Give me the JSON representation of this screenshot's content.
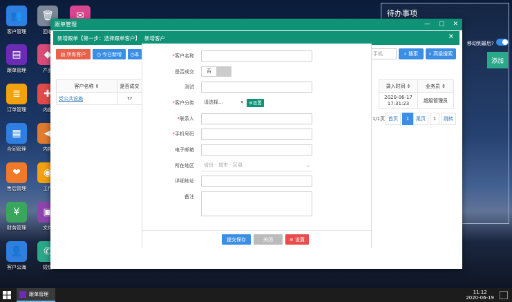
{
  "desktop": {
    "icons": [
      {
        "label": "客户管理",
        "color": "#2f7fe0",
        "glyph": "👥"
      },
      {
        "label": "回收",
        "color": "#7a8796",
        "glyph": "🗑"
      },
      {
        "label": "",
        "color": "#d9468f",
        "glyph": "✉"
      },
      {
        "label": "跟单管理",
        "color": "#6a2cb5",
        "glyph": "▤"
      },
      {
        "label": "产品",
        "color": "#d94c7a",
        "glyph": "◆"
      },
      {
        "label": "订单管理",
        "color": "#f2a20c",
        "glyph": "≣"
      },
      {
        "label": "内部",
        "color": "#e14b4b",
        "glyph": "✚"
      },
      {
        "label": "合同管理",
        "color": "#2f7fe0",
        "glyph": "▦"
      },
      {
        "label": "内部",
        "color": "#e07b2f",
        "glyph": "◀"
      },
      {
        "label": "售后管理",
        "color": "#f07a2a",
        "glyph": "❤"
      },
      {
        "label": "工作",
        "color": "#f2a20c",
        "glyph": "◉"
      },
      {
        "label": "财务管理",
        "color": "#3aa55d",
        "glyph": "¥"
      },
      {
        "label": "文件",
        "color": "#8e44ad",
        "glyph": "▣"
      },
      {
        "label": "客户公海",
        "color": "#2f7fe0",
        "glyph": "👤"
      },
      {
        "label": "短信",
        "color": "#2aa889",
        "glyph": "✆"
      }
    ]
  },
  "todo": {
    "title": "待办事项",
    "auto_remind": "移动到最后?",
    "add_label": "添加"
  },
  "main_window": {
    "title": "跟单管理",
    "minimize": "—",
    "maximize": "▢",
    "close": "✕"
  },
  "sub_window": {
    "title": "新增跟单【第一步：选择跟单客户】",
    "dialog_title": "新增客户",
    "close": "✕"
  },
  "toolbar": {
    "all_customers": "所有客户",
    "today_new": "今日新增",
    "btn3": "本",
    "btn4": "",
    "search_placeholder": "手机",
    "search": "搜索",
    "advanced_search": "高级搜索"
  },
  "grid": {
    "columns": [
      "客户名称",
      "是否成交"
    ],
    "rows": [
      [
        "党公共设施",
        "??"
      ]
    ],
    "right_columns": [
      "录入时间",
      "业务员"
    ],
    "right_rows": [
      [
        "2020-06-17 17:31:23",
        "超级管理员"
      ]
    ],
    "pager": {
      "count": "1/1页",
      "first": "首页",
      "current": "1",
      "last": "尾页",
      "page_input": "1",
      "go": "跳转"
    }
  },
  "form": {
    "fields": [
      {
        "label": "客户名称",
        "required": "*",
        "value": ""
      },
      {
        "label": "是否成交",
        "required": "",
        "value": "否"
      },
      {
        "label": "测试",
        "required": "",
        "value": ""
      },
      {
        "label": "客户分类",
        "required": "*",
        "value": "请选择..."
      },
      {
        "label": "联系人",
        "required": "*",
        "value": ""
      },
      {
        "label": "手机号码",
        "required": "*",
        "value": ""
      },
      {
        "label": "电子邮箱",
        "required": "",
        "value": ""
      },
      {
        "label": "所在地区",
        "required": "",
        "value": "省份 - 城市 - 区县"
      },
      {
        "label": "详细地址",
        "required": "",
        "value": ""
      },
      {
        "label": "备注",
        "required": "",
        "value": ""
      }
    ],
    "category_settings": "设置",
    "submit": "提交保存",
    "close": "关闭",
    "settings": "设置"
  },
  "taskbar": {
    "app_label": "跟单管理",
    "time": "11:12",
    "date": "2020-06-19"
  }
}
